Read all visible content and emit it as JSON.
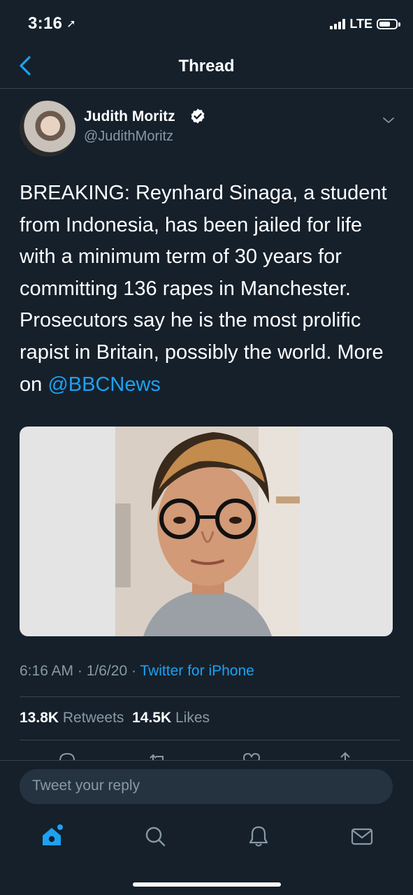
{
  "status_bar": {
    "time": "3:16",
    "network": "LTE"
  },
  "header": {
    "title": "Thread"
  },
  "tweet": {
    "author_name": "Judith Moritz",
    "author_handle": "@JudithMoritz",
    "text_before_mention": "BREAKING: Reynhard Sinaga, a student from Indonesia, has been jailed for life with a minimum term of 30 years for committing 136 rapes in Manchester. Prosecutors say he is the most prolific rapist in Britain, possibly the world. More on ",
    "mention": "@BBCNews",
    "time": "6:16 AM",
    "date": "1/6/20",
    "source": "Twitter for iPhone",
    "retweets_count": "13.8K",
    "retweets_label": "Retweets",
    "likes_count": "14.5K",
    "likes_label": "Likes"
  },
  "reply": {
    "placeholder": "Tweet your reply"
  },
  "colors": {
    "background": "#15202b",
    "accent": "#1da1f2",
    "secondary_text": "#8899a6",
    "divider": "#38444d"
  },
  "tab_bar": [
    "home-icon",
    "search-icon",
    "notifications-icon",
    "messages-icon"
  ]
}
